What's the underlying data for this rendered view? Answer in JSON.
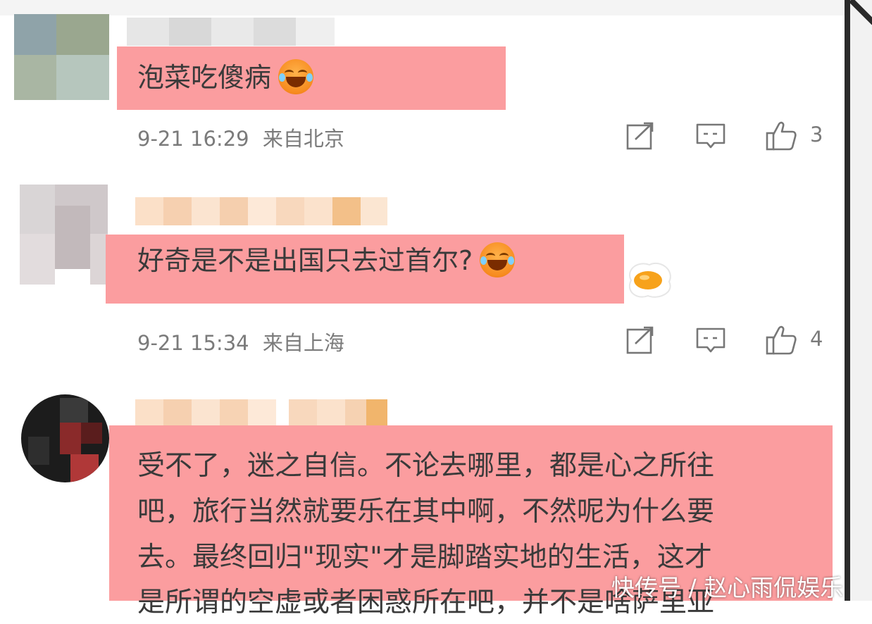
{
  "comments": [
    {
      "text": "泡菜吃傻病",
      "emoji_icon": "laughing-crying-face",
      "time": "9-21 16:29",
      "location": "来自北京",
      "likes": "3"
    },
    {
      "text": "好奇是不是出国只去过首尔?",
      "emoji_icon": "laughing-crying-face",
      "time": "9-21 15:34",
      "location": "来自上海",
      "likes": "4"
    },
    {
      "lines": [
        "受不了，迷之自信。不论去哪里，都是心之所往",
        "吧，旅行当然就要乐在其中啊，不然呢为什么要",
        "去。最终回归\"现实\"才是脚踏实地的生活，这才",
        "是所谓的空虚或者困惑所在吧，并不是啥萨里亚"
      ]
    }
  ],
  "actions": {
    "repost_icon": "repost-icon",
    "comment_icon": "comment-icon",
    "like_icon": "thumbs-up-icon"
  },
  "watermark": "快传号 / 赵心雨侃娱乐",
  "colors": {
    "highlight": "#fb9d9f",
    "meta_text": "#7b7b7b",
    "body_text": "#3a3a3a"
  }
}
